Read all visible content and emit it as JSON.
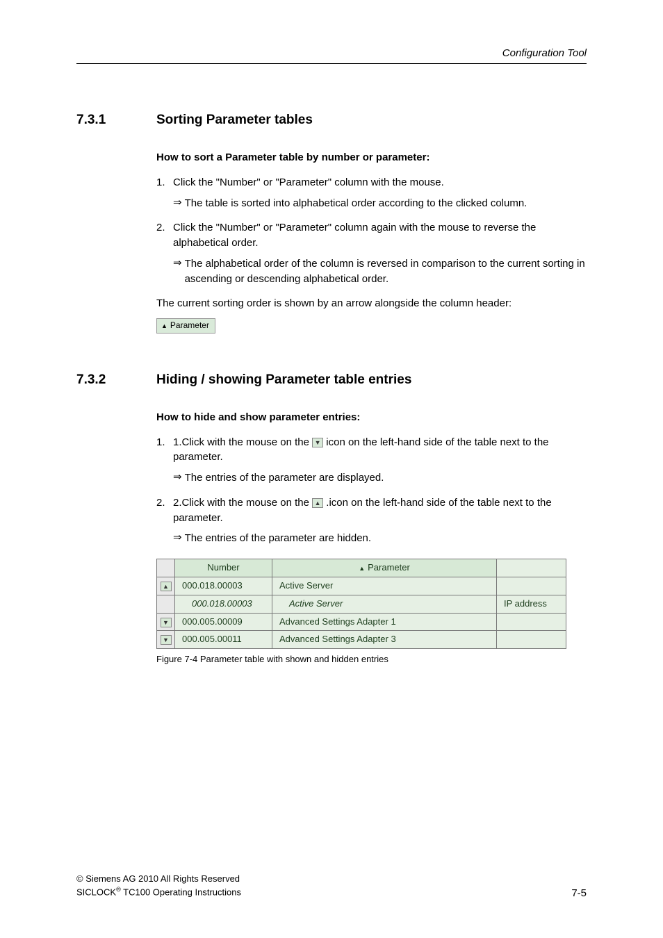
{
  "header": {
    "section_label": "Configuration Tool"
  },
  "s1": {
    "num": "7.3.1",
    "title": "Sorting Parameter tables",
    "howto": "How to sort a Parameter table by number or parameter:",
    "step1_num": "1.",
    "step1_text": "Click the \"Number\" or \"Parameter\" column with the mouse.",
    "step1_result": "The table is sorted into alphabetical order according to the clicked column.",
    "step2_num": "2.",
    "step2_text": "Click the \"Number\" or \"Parameter\" column again with the mouse to reverse the alphabetical order.",
    "step2_result": "The alphabetical order of the column is reversed in comparison to the current sorting in ascending or descending alphabetical order.",
    "note": "The current sorting order is shown by an arrow alongside the column header:",
    "badge_label": "Parameter"
  },
  "s2": {
    "num": "7.3.2",
    "title": "Hiding / showing Parameter table entries",
    "howto": "How to hide and show parameter entries:",
    "step1_num": "1.",
    "step1_a": "1.Click with the mouse on the ",
    "step1_b": " icon on the left-hand side of the table next to the parameter.",
    "step1_result": "The entries of the parameter are displayed.",
    "step2_num": "2.",
    "step2_a": "2.Click with the mouse on the ",
    "step2_b": " .icon on the left-hand side of the table next to the parameter.",
    "step2_result": " The entries of the parameter are hidden.",
    "table": {
      "col_number": "Number",
      "col_parameter": "Parameter",
      "rows": [
        {
          "icon": "▲",
          "num": "000.018.00003",
          "param": "Active Server",
          "val": ""
        },
        {
          "icon": "",
          "num": "000.018.00003",
          "param": "Active Server",
          "val": "IP address",
          "sub": true
        },
        {
          "icon": "▼",
          "num": "000.005.00009",
          "param": "Advanced Settings Adapter 1",
          "val": ""
        },
        {
          "icon": "▼",
          "num": "000.005.00011",
          "param": "Advanced Settings Adapter 3",
          "val": ""
        }
      ]
    },
    "figcap": "Figure 7-4 Parameter table with shown and hidden entries"
  },
  "footer": {
    "copyright": "©  Siemens AG 2010 All Rights Reserved",
    "doc_a": "SICLOCK",
    "doc_b": " TC100 Operating Instructions",
    "page": "7-5"
  }
}
